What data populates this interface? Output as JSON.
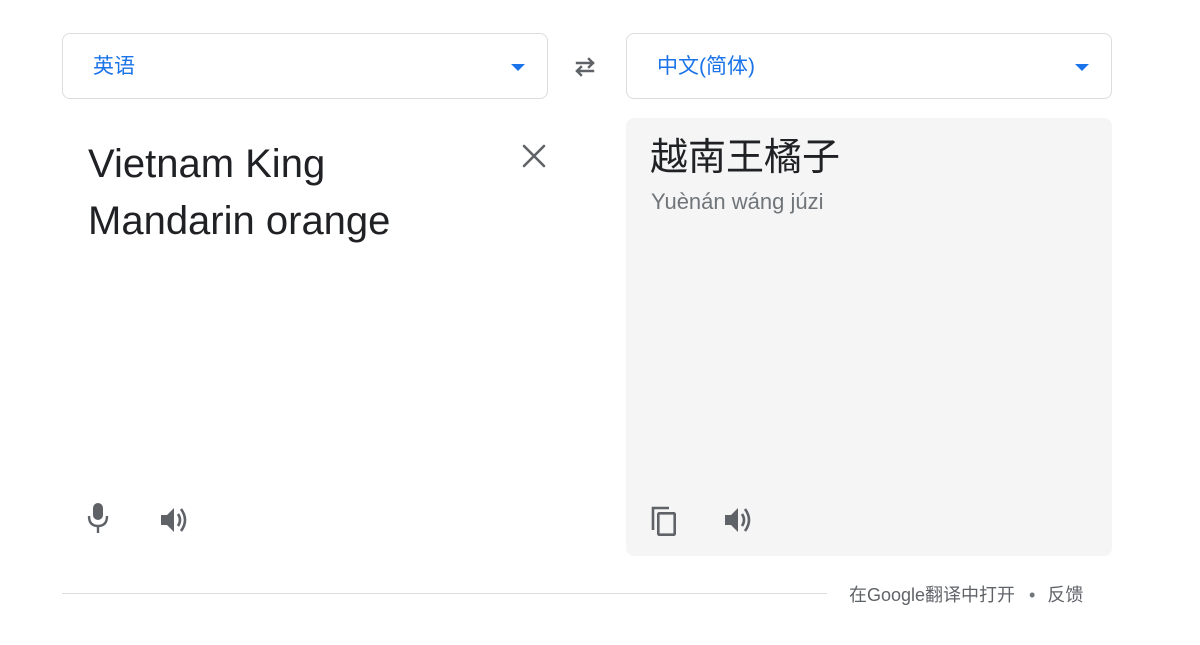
{
  "source_language": {
    "label": "英语"
  },
  "target_language": {
    "label": "中文(简体)"
  },
  "source": {
    "text": "Vietnam King\nMandarin orange"
  },
  "target": {
    "text": "越南王橘子",
    "romanization": "Yuènán wáng júzi"
  },
  "footer": {
    "open_in_translate": "在Google翻译中打开",
    "separator": "•",
    "feedback": "反馈"
  },
  "colors": {
    "accent": "#1a73e8",
    "icon": "#5f6368",
    "target_bg": "#f5f5f5"
  }
}
